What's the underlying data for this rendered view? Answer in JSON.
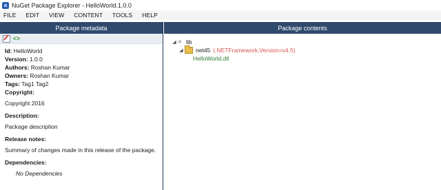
{
  "window": {
    "title": "NuGet Package Explorer - HelloWorld.1.0.0"
  },
  "menu": [
    "FILE",
    "EDIT",
    "VIEW",
    "CONTENT",
    "TOOLS",
    "HELP"
  ],
  "left_pane": {
    "header": "Package metadata",
    "fields": [
      {
        "label": "Id:",
        "value": "HelloWorld"
      },
      {
        "label": "Version:",
        "value": "1.0.0"
      },
      {
        "label": "Authors:",
        "value": "Roshan Kumar"
      },
      {
        "label": "Owners:",
        "value": "Roshan Kumar"
      },
      {
        "label": "Tags:",
        "value": "Tag1 Tag2"
      }
    ],
    "copyright_label": "Copyright:",
    "copyright_value": "Copyright 2016",
    "description_label": "Description:",
    "description_value": "Package description",
    "release_notes_label": "Release notes:",
    "release_notes_value": "Summary of changes made in this release of the package.",
    "dependencies_label": "Dependencies:",
    "dependencies_value": "No Dependencies"
  },
  "right_pane": {
    "header": "Package contents",
    "tree": {
      "root": "lib",
      "folder": "net45",
      "framework": "(.NETFramework,Version=v4.5)",
      "file": "HelloWorld.dll"
    }
  },
  "colors": {
    "header_bg": "#2f4a6d",
    "framework_text": "#d9534f",
    "file_text": "#2a7a2a"
  }
}
